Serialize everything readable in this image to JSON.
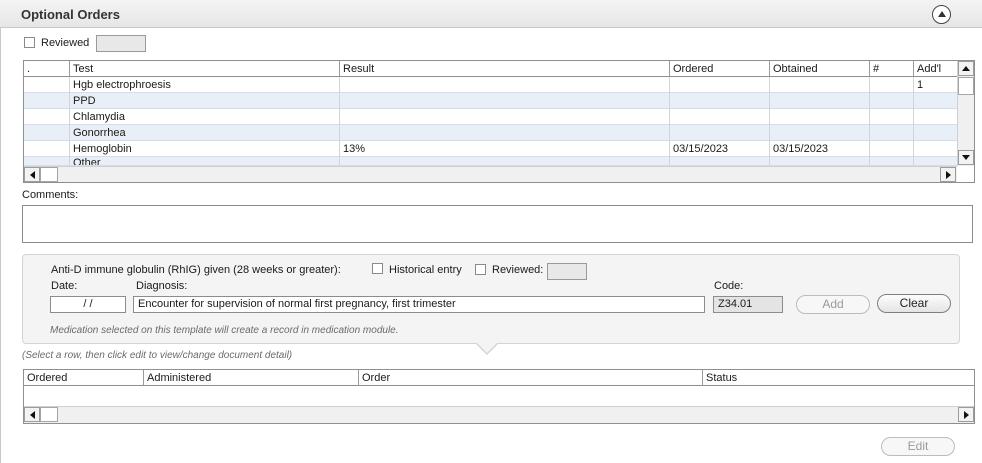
{
  "header": {
    "title": "Optional Orders"
  },
  "reviewed": {
    "label": "Reviewed",
    "value": ""
  },
  "orders_grid": {
    "columns": [
      ".",
      "Test",
      "Result",
      "Ordered",
      "Obtained",
      "#",
      "Add'l"
    ],
    "rows": [
      {
        "dot": "",
        "test": "Hgb electrophroesis",
        "result": "",
        "ordered": "",
        "obtained": "",
        "num": "",
        "addl": "1"
      },
      {
        "dot": "",
        "test": "PPD",
        "result": "",
        "ordered": "",
        "obtained": "",
        "num": "",
        "addl": ""
      },
      {
        "dot": "",
        "test": "Chlamydia",
        "result": "",
        "ordered": "",
        "obtained": "",
        "num": "",
        "addl": ""
      },
      {
        "dot": "",
        "test": "Gonorrhea",
        "result": "",
        "ordered": "",
        "obtained": "",
        "num": "",
        "addl": ""
      },
      {
        "dot": "",
        "test": "Hemoglobin",
        "result": "13%",
        "ordered": "03/15/2023",
        "obtained": "03/15/2023",
        "num": "",
        "addl": ""
      },
      {
        "dot": "",
        "test": "Other",
        "result": "",
        "ordered": "",
        "obtained": "",
        "num": "",
        "addl": ""
      }
    ]
  },
  "comments": {
    "label": "Comments:",
    "value": ""
  },
  "rhig": {
    "title": "Anti-D immune globulin (RhIG) given (28 weeks or greater):",
    "historical_label": "Historical entry",
    "reviewed_label": "Reviewed:",
    "reviewed_value": "",
    "date_label": "Date:",
    "date_value": "/ /",
    "diagnosis_label": "Diagnosis:",
    "diagnosis_value": "Encounter for supervision of normal first pregnancy, first trimester",
    "code_label": "Code:",
    "code_value": "Z34.01",
    "add_label": "Add",
    "clear_label": "Clear",
    "note": "Medication selected on this template will create a record in medication module."
  },
  "hint": "(Select a row, then click edit to view/change document detail)",
  "doc_grid": {
    "columns": [
      "Ordered",
      "Administered",
      "Order",
      "Status"
    ]
  },
  "edit_label": "Edit"
}
